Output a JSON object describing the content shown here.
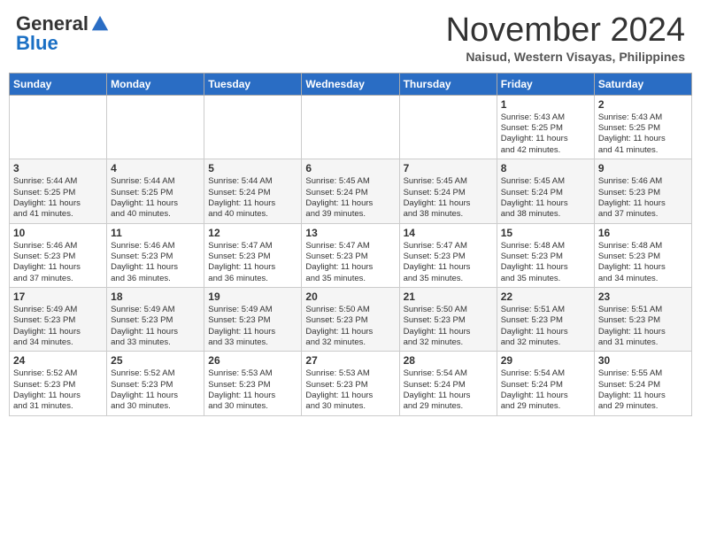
{
  "header": {
    "logo_general": "General",
    "logo_blue": "Blue",
    "month_title": "November 2024",
    "location": "Naisud, Western Visayas, Philippines"
  },
  "weekdays": [
    "Sunday",
    "Monday",
    "Tuesday",
    "Wednesday",
    "Thursday",
    "Friday",
    "Saturday"
  ],
  "rows": [
    [
      {
        "day": "",
        "info": ""
      },
      {
        "day": "",
        "info": ""
      },
      {
        "day": "",
        "info": ""
      },
      {
        "day": "",
        "info": ""
      },
      {
        "day": "",
        "info": ""
      },
      {
        "day": "1",
        "info": "Sunrise: 5:43 AM\nSunset: 5:25 PM\nDaylight: 11 hours\nand 42 minutes."
      },
      {
        "day": "2",
        "info": "Sunrise: 5:43 AM\nSunset: 5:25 PM\nDaylight: 11 hours\nand 41 minutes."
      }
    ],
    [
      {
        "day": "3",
        "info": "Sunrise: 5:44 AM\nSunset: 5:25 PM\nDaylight: 11 hours\nand 41 minutes."
      },
      {
        "day": "4",
        "info": "Sunrise: 5:44 AM\nSunset: 5:25 PM\nDaylight: 11 hours\nand 40 minutes."
      },
      {
        "day": "5",
        "info": "Sunrise: 5:44 AM\nSunset: 5:24 PM\nDaylight: 11 hours\nand 40 minutes."
      },
      {
        "day": "6",
        "info": "Sunrise: 5:45 AM\nSunset: 5:24 PM\nDaylight: 11 hours\nand 39 minutes."
      },
      {
        "day": "7",
        "info": "Sunrise: 5:45 AM\nSunset: 5:24 PM\nDaylight: 11 hours\nand 38 minutes."
      },
      {
        "day": "8",
        "info": "Sunrise: 5:45 AM\nSunset: 5:24 PM\nDaylight: 11 hours\nand 38 minutes."
      },
      {
        "day": "9",
        "info": "Sunrise: 5:46 AM\nSunset: 5:23 PM\nDaylight: 11 hours\nand 37 minutes."
      }
    ],
    [
      {
        "day": "10",
        "info": "Sunrise: 5:46 AM\nSunset: 5:23 PM\nDaylight: 11 hours\nand 37 minutes."
      },
      {
        "day": "11",
        "info": "Sunrise: 5:46 AM\nSunset: 5:23 PM\nDaylight: 11 hours\nand 36 minutes."
      },
      {
        "day": "12",
        "info": "Sunrise: 5:47 AM\nSunset: 5:23 PM\nDaylight: 11 hours\nand 36 minutes."
      },
      {
        "day": "13",
        "info": "Sunrise: 5:47 AM\nSunset: 5:23 PM\nDaylight: 11 hours\nand 35 minutes."
      },
      {
        "day": "14",
        "info": "Sunrise: 5:47 AM\nSunset: 5:23 PM\nDaylight: 11 hours\nand 35 minutes."
      },
      {
        "day": "15",
        "info": "Sunrise: 5:48 AM\nSunset: 5:23 PM\nDaylight: 11 hours\nand 35 minutes."
      },
      {
        "day": "16",
        "info": "Sunrise: 5:48 AM\nSunset: 5:23 PM\nDaylight: 11 hours\nand 34 minutes."
      }
    ],
    [
      {
        "day": "17",
        "info": "Sunrise: 5:49 AM\nSunset: 5:23 PM\nDaylight: 11 hours\nand 34 minutes."
      },
      {
        "day": "18",
        "info": "Sunrise: 5:49 AM\nSunset: 5:23 PM\nDaylight: 11 hours\nand 33 minutes."
      },
      {
        "day": "19",
        "info": "Sunrise: 5:49 AM\nSunset: 5:23 PM\nDaylight: 11 hours\nand 33 minutes."
      },
      {
        "day": "20",
        "info": "Sunrise: 5:50 AM\nSunset: 5:23 PM\nDaylight: 11 hours\nand 32 minutes."
      },
      {
        "day": "21",
        "info": "Sunrise: 5:50 AM\nSunset: 5:23 PM\nDaylight: 11 hours\nand 32 minutes."
      },
      {
        "day": "22",
        "info": "Sunrise: 5:51 AM\nSunset: 5:23 PM\nDaylight: 11 hours\nand 32 minutes."
      },
      {
        "day": "23",
        "info": "Sunrise: 5:51 AM\nSunset: 5:23 PM\nDaylight: 11 hours\nand 31 minutes."
      }
    ],
    [
      {
        "day": "24",
        "info": "Sunrise: 5:52 AM\nSunset: 5:23 PM\nDaylight: 11 hours\nand 31 minutes."
      },
      {
        "day": "25",
        "info": "Sunrise: 5:52 AM\nSunset: 5:23 PM\nDaylight: 11 hours\nand 30 minutes."
      },
      {
        "day": "26",
        "info": "Sunrise: 5:53 AM\nSunset: 5:23 PM\nDaylight: 11 hours\nand 30 minutes."
      },
      {
        "day": "27",
        "info": "Sunrise: 5:53 AM\nSunset: 5:23 PM\nDaylight: 11 hours\nand 30 minutes."
      },
      {
        "day": "28",
        "info": "Sunrise: 5:54 AM\nSunset: 5:24 PM\nDaylight: 11 hours\nand 29 minutes."
      },
      {
        "day": "29",
        "info": "Sunrise: 5:54 AM\nSunset: 5:24 PM\nDaylight: 11 hours\nand 29 minutes."
      },
      {
        "day": "30",
        "info": "Sunrise: 5:55 AM\nSunset: 5:24 PM\nDaylight: 11 hours\nand 29 minutes."
      }
    ]
  ]
}
